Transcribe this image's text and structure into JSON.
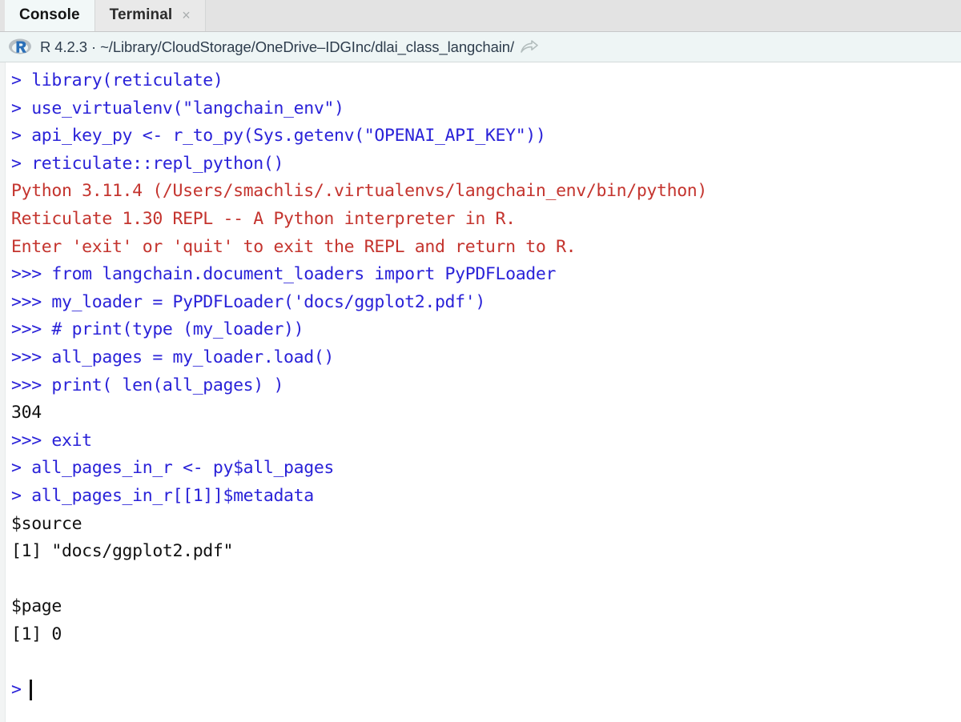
{
  "window": {
    "app": "RStudio Console"
  },
  "tabs": [
    {
      "label": "Console",
      "active": true,
      "closable": false
    },
    {
      "label": "Terminal",
      "active": false,
      "closable": true,
      "close_glyph": "×"
    }
  ],
  "pathbar": {
    "r_logo_letter": "R",
    "r_version": "R 4.2.3",
    "separator": "·",
    "working_directory": "~/Library/CloudStorage/OneDrive–IDGInc/dlai_class_langchain/",
    "full_text": "R 4.2.3  ·  ~/Library/CloudStorage/OneDrive–IDGInc/dlai_class_langchain/",
    "share_icon": "share-arrow-icon"
  },
  "colors": {
    "prompt_blue": "#2a22d8",
    "error_red": "#c4342e",
    "output_black": "#111111",
    "tabbar_bg": "#e3e3e3",
    "active_tab_bg": "#f2f8f8",
    "pathbar_bg": "#eef5f5",
    "console_bg": "#ffffff",
    "gutter_bg": "#f2f4f4"
  },
  "console": {
    "lines": [
      {
        "color": "blue",
        "text": "> library(reticulate)"
      },
      {
        "color": "blue",
        "text": "> use_virtualenv(\"langchain_env\")"
      },
      {
        "color": "blue",
        "text": "> api_key_py <- r_to_py(Sys.getenv(\"OPENAI_API_KEY\"))"
      },
      {
        "color": "blue",
        "text": "> reticulate::repl_python()"
      },
      {
        "color": "red",
        "text": "Python 3.11.4 (/Users/smachlis/.virtualenvs/langchain_env/bin/python)"
      },
      {
        "color": "red",
        "text": "Reticulate 1.30 REPL -- A Python interpreter in R."
      },
      {
        "color": "red",
        "text": "Enter 'exit' or 'quit' to exit the REPL and return to R."
      },
      {
        "color": "blue",
        "text": ">>> from langchain.document_loaders import PyPDFLoader"
      },
      {
        "color": "blue",
        "text": ">>> my_loader = PyPDFLoader('docs/ggplot2.pdf')"
      },
      {
        "color": "blue",
        "text": ">>> # print(type (my_loader))"
      },
      {
        "color": "blue",
        "text": ">>> all_pages = my_loader.load()"
      },
      {
        "color": "blue",
        "text": ">>> print( len(all_pages) )"
      },
      {
        "color": "black",
        "text": "304"
      },
      {
        "color": "blue",
        "text": ">>> exit"
      },
      {
        "color": "blue",
        "text": "> all_pages_in_r <- py$all_pages"
      },
      {
        "color": "blue",
        "text": "> all_pages_in_r[[1]]$metadata"
      },
      {
        "color": "black",
        "text": "$source"
      },
      {
        "color": "black",
        "text": "[1] \"docs/ggplot2.pdf\""
      },
      {
        "color": "blank",
        "text": " "
      },
      {
        "color": "black",
        "text": "$page"
      },
      {
        "color": "black",
        "text": "[1] 0"
      },
      {
        "color": "blank",
        "text": " "
      }
    ],
    "active_prompt": ">",
    "cursor": "text-caret"
  }
}
